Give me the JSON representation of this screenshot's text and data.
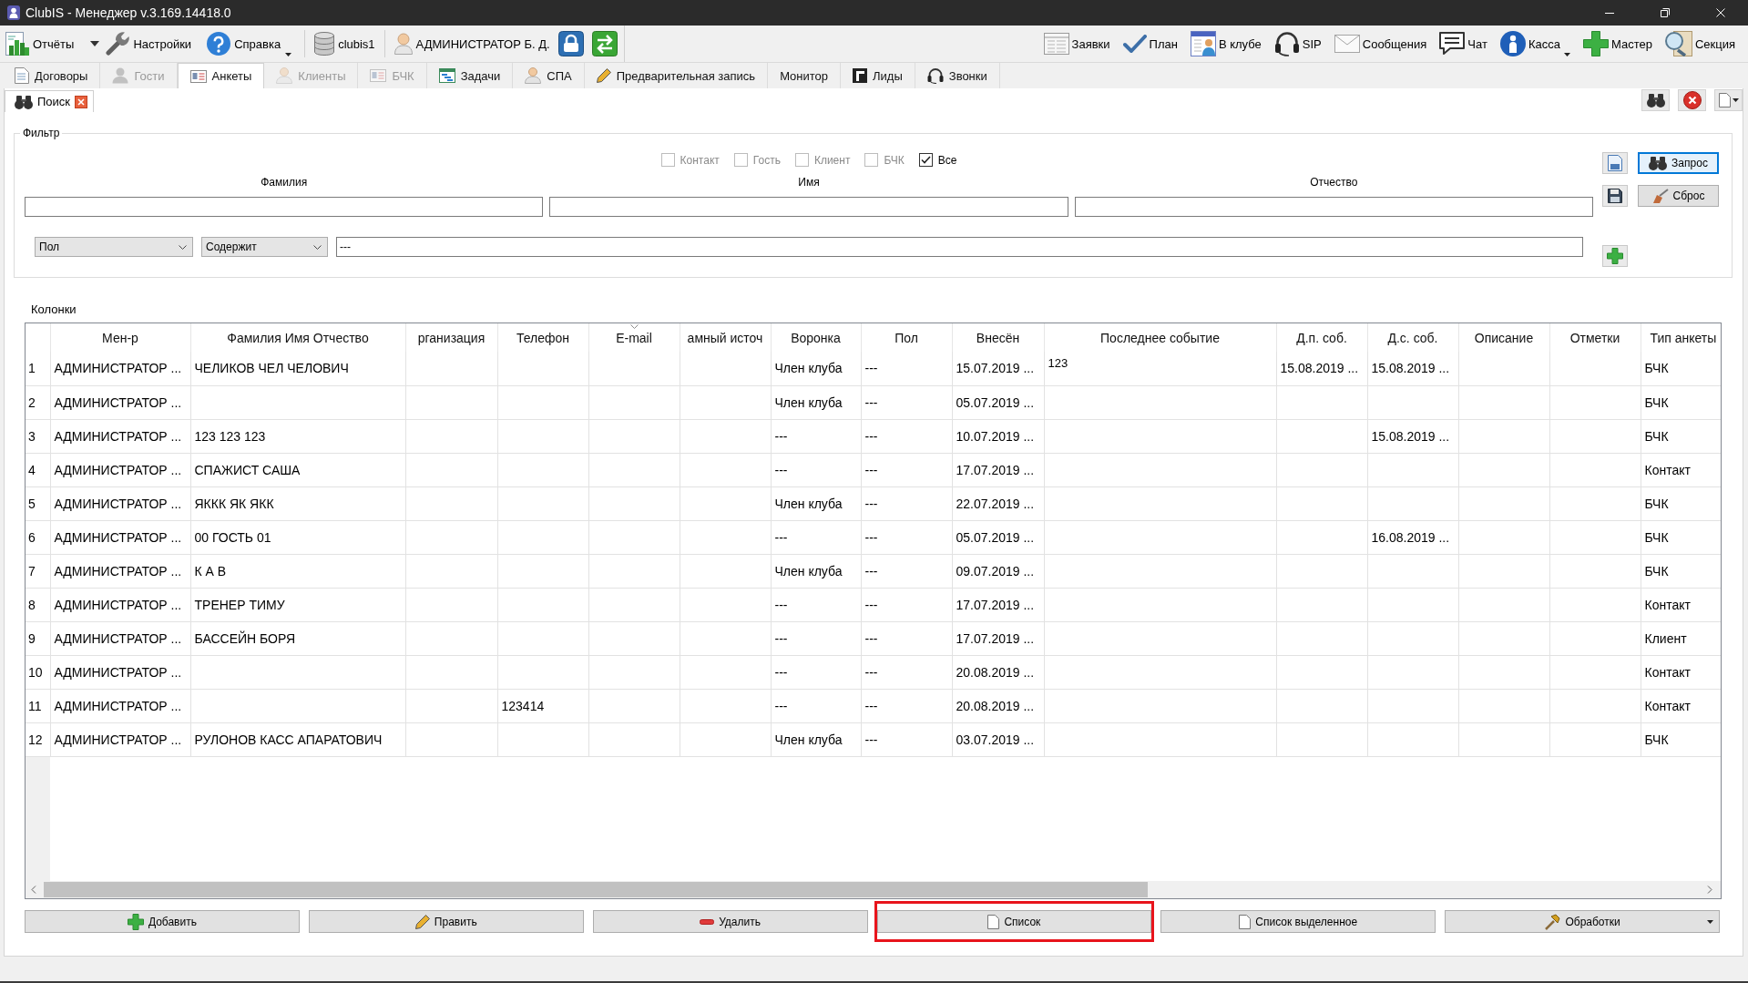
{
  "window": {
    "title": "ClubIS - Менеджер v.3.169.14418.0"
  },
  "toolbar": {
    "main_buttons": [
      {
        "label": "Отчёты",
        "dropdown": false,
        "split": true
      },
      {
        "label": "Настройки",
        "dropdown": false,
        "split": false
      },
      {
        "label": "Справка",
        "dropdown": true,
        "split": false
      }
    ],
    "database": {
      "label": "clubis1"
    },
    "user": {
      "label": "АДМИНИСТРАТОР Б. Д."
    },
    "right_buttons": [
      {
        "label": "Заявки",
        "dropdown": false,
        "split": false
      },
      {
        "label": "План",
        "dropdown": false,
        "split": false
      },
      {
        "label": "В клубе",
        "dropdown": false,
        "split": false
      },
      {
        "label": "SIP",
        "dropdown": false,
        "split": false
      },
      {
        "label": "Сообщения",
        "dropdown": false,
        "split": false
      },
      {
        "label": "Чат",
        "dropdown": false,
        "split": false
      },
      {
        "label": "Касса",
        "dropdown": true,
        "split": false
      },
      {
        "label": "Мастер",
        "dropdown": false,
        "split": false
      },
      {
        "label": "Секция",
        "dropdown": false,
        "split": false
      }
    ]
  },
  "tabs": [
    {
      "label": "Договоры",
      "selected": false,
      "disabled": false
    },
    {
      "label": "Гости",
      "selected": false,
      "disabled": true
    },
    {
      "label": "Анкеты",
      "selected": true,
      "disabled": false
    },
    {
      "label": "Клиенты",
      "selected": false,
      "disabled": true
    },
    {
      "label": "БЧК",
      "selected": false,
      "disabled": true
    },
    {
      "label": "Задачи",
      "selected": false,
      "disabled": false
    },
    {
      "label": "СПА",
      "selected": false,
      "disabled": false
    },
    {
      "label": "Предварительная запись",
      "selected": false,
      "disabled": false
    },
    {
      "label": "Монитор",
      "selected": false,
      "disabled": false
    },
    {
      "label": "Лиды",
      "selected": false,
      "disabled": false
    },
    {
      "label": "Звонки",
      "selected": false,
      "disabled": false
    }
  ],
  "subtabs": [
    {
      "label": "Поиск",
      "selected": true,
      "closable": true
    }
  ],
  "filter": {
    "title": "Фильтр",
    "types": [
      {
        "label": "Контакт",
        "checked": false,
        "disabled": true
      },
      {
        "label": "Гость",
        "checked": false,
        "disabled": true
      },
      {
        "label": "Клиент",
        "checked": false,
        "disabled": true
      },
      {
        "label": "БЧК",
        "checked": false,
        "disabled": true
      },
      {
        "label": "Все",
        "checked": true,
        "disabled": false
      }
    ],
    "name_fields": [
      {
        "label": "Фамилия"
      },
      {
        "label": "Имя"
      },
      {
        "label": "Отчество"
      }
    ],
    "condition": {
      "field": "Пол",
      "operator": "Содержит",
      "value": "---"
    },
    "buttons": [
      {
        "label": "Запрос",
        "default": true
      },
      {
        "label": "Сброс",
        "default": false
      }
    ]
  },
  "columns_title": "Колонки",
  "table": {
    "columns": [
      {
        "label": "Мен-р",
        "sorted": false
      },
      {
        "label": "Фамилия Имя Отчество",
        "sorted": false
      },
      {
        "label": "рганизация",
        "sorted": false
      },
      {
        "label": "Телефон",
        "sorted": false
      },
      {
        "label": "E-mail",
        "sorted": true
      },
      {
        "label": "амный источ",
        "sorted": false
      },
      {
        "label": "Воронка",
        "sorted": false
      },
      {
        "label": "Пол",
        "sorted": false
      },
      {
        "label": "Внесён",
        "sorted": false
      },
      {
        "label": "Последнее событие",
        "sorted": false
      },
      {
        "label": "Д.п. соб.",
        "sorted": false
      },
      {
        "label": "Д.с. соб.",
        "sorted": false
      },
      {
        "label": "Описание",
        "sorted": false
      },
      {
        "label": "Отметки",
        "sorted": false
      },
      {
        "label": "Тип анкеты",
        "sorted": false
      }
    ],
    "rows": [
      {
        "number": "1",
        "cells": [
          "АДМИНИСТРАТОР ...",
          "ЧЕЛИКОВ ЧЕЛ ЧЕЛОВИЧ",
          null,
          null,
          null,
          null,
          "Член клуба",
          "---",
          "15.07.2019 ...",
          "123",
          "15.08.2019 ...",
          "15.08.2019 ...",
          null,
          null,
          "БЧК"
        ]
      },
      {
        "number": "2",
        "cells": [
          "АДМИНИСТРАТОР ...",
          null,
          null,
          null,
          null,
          null,
          "Член клуба",
          "---",
          "05.07.2019 ...",
          null,
          null,
          null,
          null,
          null,
          "БЧК"
        ]
      },
      {
        "number": "3",
        "cells": [
          "АДМИНИСТРАТОР ...",
          "123 123 123",
          null,
          null,
          null,
          null,
          "---",
          "---",
          "10.07.2019 ...",
          null,
          null,
          "15.08.2019 ...",
          null,
          null,
          "БЧК"
        ]
      },
      {
        "number": "4",
        "cells": [
          "АДМИНИСТРАТОР ...",
          "СПАЖИСТ САША",
          null,
          null,
          null,
          null,
          "---",
          "---",
          "17.07.2019 ...",
          null,
          null,
          null,
          null,
          null,
          "Контакт"
        ]
      },
      {
        "number": "5",
        "cells": [
          "АДМИНИСТРАТОР ...",
          "ЯККК ЯК ЯКК",
          null,
          null,
          null,
          null,
          "Член клуба",
          "---",
          "22.07.2019 ...",
          null,
          null,
          null,
          null,
          null,
          "БЧК"
        ]
      },
      {
        "number": "6",
        "cells": [
          "АДМИНИСТРАТОР ...",
          "00 ГОСТЬ 01",
          null,
          null,
          null,
          null,
          "---",
          "---",
          "05.07.2019 ...",
          null,
          null,
          "16.08.2019 ...",
          null,
          null,
          "БЧК"
        ]
      },
      {
        "number": "7",
        "cells": [
          "АДМИНИСТРАТОР ...",
          "К А В",
          null,
          null,
          null,
          null,
          "Член клуба",
          "---",
          "09.07.2019 ...",
          null,
          null,
          null,
          null,
          null,
          "БЧК"
        ]
      },
      {
        "number": "8",
        "cells": [
          "АДМИНИСТРАТОР ...",
          "ТРЕНЕР ТИМУ",
          null,
          null,
          null,
          null,
          "---",
          "---",
          "17.07.2019 ...",
          null,
          null,
          null,
          null,
          null,
          "Контакт"
        ]
      },
      {
        "number": "9",
        "cells": [
          "АДМИНИСТРАТОР ...",
          "БАССЕЙН БОРЯ",
          null,
          null,
          null,
          null,
          "---",
          "---",
          "17.07.2019 ...",
          null,
          null,
          null,
          null,
          null,
          "Клиент"
        ]
      },
      {
        "number": "10",
        "cells": [
          "АДМИНИСТРАТОР ...",
          null,
          null,
          null,
          null,
          null,
          "---",
          "---",
          "20.08.2019 ...",
          null,
          null,
          null,
          null,
          null,
          "Контакт"
        ]
      },
      {
        "number": "11",
        "cells": [
          "АДМИНИСТРАТОР ...",
          null,
          null,
          "123414",
          null,
          null,
          "---",
          "---",
          "20.08.2019 ...",
          null,
          null,
          null,
          null,
          null,
          "Контакт"
        ]
      },
      {
        "number": "12",
        "cells": [
          "АДМИНИСТРАТОР ...",
          "РУЛОНОВ КАСС АПАРАТОВИЧ",
          null,
          null,
          null,
          null,
          "Член клуба",
          "---",
          "03.07.2019 ...",
          null,
          null,
          null,
          null,
          null,
          "БЧК"
        ]
      }
    ]
  },
  "actions": [
    {
      "label": "Добавить",
      "highlighted": false,
      "dropdown": false
    },
    {
      "label": "Править",
      "highlighted": false,
      "dropdown": false
    },
    {
      "label": "Удалить",
      "highlighted": false,
      "dropdown": false
    },
    {
      "label": "Список",
      "highlighted": true,
      "dropdown": false
    },
    {
      "label": "Список выделенное",
      "highlighted": false,
      "dropdown": false
    },
    {
      "label": "Обработки",
      "highlighted": false,
      "dropdown": true
    }
  ]
}
